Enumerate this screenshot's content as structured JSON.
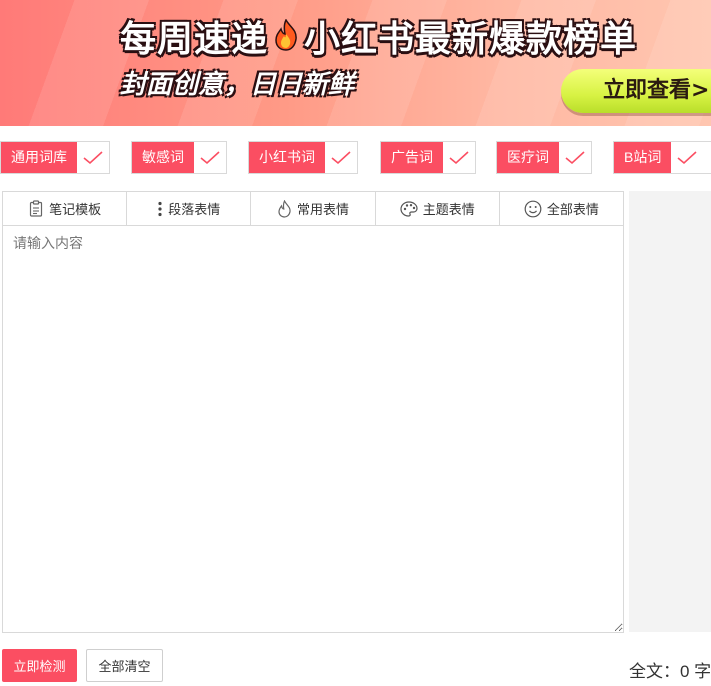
{
  "banner": {
    "title_left": "每周速递",
    "title_right": "小红书最新爆款榜单",
    "subtitle": "封面创意，日日新鲜",
    "cta": "立即查看>>",
    "flame_icon": "flame-icon"
  },
  "word_lists": [
    {
      "label": "通用词库",
      "checked": true
    },
    {
      "label": "敏感词",
      "checked": true
    },
    {
      "label": "小红书词",
      "checked": true
    },
    {
      "label": "广告词",
      "checked": true
    },
    {
      "label": "医疗词",
      "checked": true
    },
    {
      "label": "B站词",
      "checked": true
    }
  ],
  "toolbar": {
    "items": [
      {
        "label": "笔记模板",
        "icon": "clipboard-icon"
      },
      {
        "label": "段落表情",
        "icon": "vertical-dots-icon"
      },
      {
        "label": "常用表情",
        "icon": "fire-icon"
      },
      {
        "label": "主题表情",
        "icon": "palette-icon"
      },
      {
        "label": "全部表情",
        "icon": "smiley-icon"
      }
    ]
  },
  "editor": {
    "placeholder": "请输入内容",
    "value": ""
  },
  "actions": {
    "detect": "立即检测",
    "clear": "全部清空"
  },
  "stats": {
    "word_count_text": "全文：0 字"
  },
  "colors": {
    "accent": "#fb4e62",
    "check": "#fb4e62",
    "cta": "#d7f243"
  }
}
